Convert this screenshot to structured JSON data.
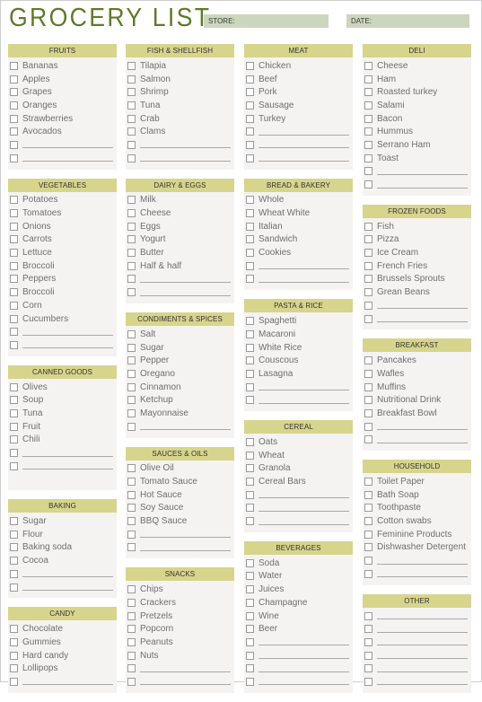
{
  "title": "GROCERY LIST",
  "fields": {
    "store_label": "STORE:",
    "date_label": "DATE:"
  },
  "columns": [
    [
      {
        "name": "FRUITS",
        "items": [
          "Bananas",
          "Apples",
          "Grapes",
          "Oranges",
          "Strawberries",
          "Avocados"
        ],
        "blanks": 2
      },
      {
        "name": "VEGETABLES",
        "items": [
          "Potatoes",
          "Tomatoes",
          "Onions",
          "Carrots",
          "Lettuce",
          "Broccoli",
          "Peppers",
          "Broccoli",
          "Corn",
          "Cucumbers"
        ],
        "blanks": 2
      },
      {
        "name": "CANNED GOODS",
        "items": [
          "Olives",
          "Soup",
          "Tuna",
          "Fruit",
          "Chili"
        ],
        "blanks": 2,
        "extra_space": 1
      },
      {
        "name": "BAKING",
        "items": [
          "Sugar",
          "Flour",
          "Baking soda",
          "Cocoa"
        ],
        "blanks": 2
      },
      {
        "name": "CANDY",
        "items": [
          "Chocolate",
          "Gummies",
          "Hard candy",
          "Lollipops"
        ],
        "blanks": 1
      }
    ],
    [
      {
        "name": "FISH & SHELLFISH",
        "items": [
          "Tilapia",
          "Salmon",
          "Shrimp",
          "Tuna",
          "Crab",
          "Clams"
        ],
        "blanks": 2
      },
      {
        "name": "DAIRY & EGGS",
        "items": [
          "Milk",
          "Cheese",
          "Eggs",
          "Yogurt",
          "Butter",
          "Half & half"
        ],
        "blanks": 2
      },
      {
        "name": "CONDIMENTS & SPICES",
        "items": [
          "Salt",
          "Sugar",
          "Pepper",
          "Oregano",
          "Cinnamon",
          "Ketchup",
          "Mayonnaise"
        ],
        "blanks": 1
      },
      {
        "name": "SAUCES & OILS",
        "items": [
          "Olive Oil",
          "Tomato Sauce",
          "Hot Sauce",
          "Soy Sauce",
          "BBQ Sauce"
        ],
        "blanks": 2
      },
      {
        "name": "SNACKS",
        "items": [
          "Chips",
          "Crackers",
          "Pretzels",
          "Popcorn",
          "Peanuts",
          "Nuts"
        ],
        "blanks": 2
      }
    ],
    [
      {
        "name": "MEAT",
        "items": [
          "Chicken",
          "Beef",
          "Pork",
          "Sausage",
          "Turkey"
        ],
        "blanks": 3
      },
      {
        "name": "BREAD & BAKERY",
        "items": [
          "Whole",
          "Wheat White",
          "Italian",
          "Sandwich",
          "Cookies"
        ],
        "blanks": 2
      },
      {
        "name": "PASTA & RICE",
        "items": [
          "Spaghetti",
          "Macaroni",
          "White Rice",
          "Couscous",
          "Lasagna"
        ],
        "blanks": 2
      },
      {
        "name": "CEREAL",
        "items": [
          "Oats",
          "Wheat",
          "Granola",
          "Cereal Bars"
        ],
        "blanks": 3
      },
      {
        "name": "BEVERAGES",
        "items": [
          "Soda",
          "Water",
          "Juices",
          "Champagne",
          "Wine",
          "Beer"
        ],
        "blanks": 4
      }
    ],
    [
      {
        "name": "DELI",
        "items": [
          "Cheese",
          "Ham",
          "Roasted turkey",
          "Salami",
          "Bacon",
          "Hummus",
          "Serrano Ham",
          "Toast"
        ],
        "blanks": 2
      },
      {
        "name": "FROZEN FOODS",
        "items": [
          "Fish",
          "Pizza",
          "Ice Cream",
          "French Fries",
          "Brussels Sprouts",
          "Grean Beans"
        ],
        "blanks": 2
      },
      {
        "name": "BREAKFAST",
        "items": [
          "Pancakes",
          "Wafles",
          "Muffins",
          "Nutritional Drink",
          "Breakfast Bowl"
        ],
        "blanks": 2
      },
      {
        "name": "HOUSEHOLD",
        "items": [
          "Toilet Paper",
          "Bath Soap",
          "Toothpaste",
          "Cotton swabs",
          "Feminine Products",
          "Dishwasher Detergent"
        ],
        "blanks": 2
      },
      {
        "name": "OTHER",
        "items": [],
        "blanks": 6
      }
    ]
  ]
}
